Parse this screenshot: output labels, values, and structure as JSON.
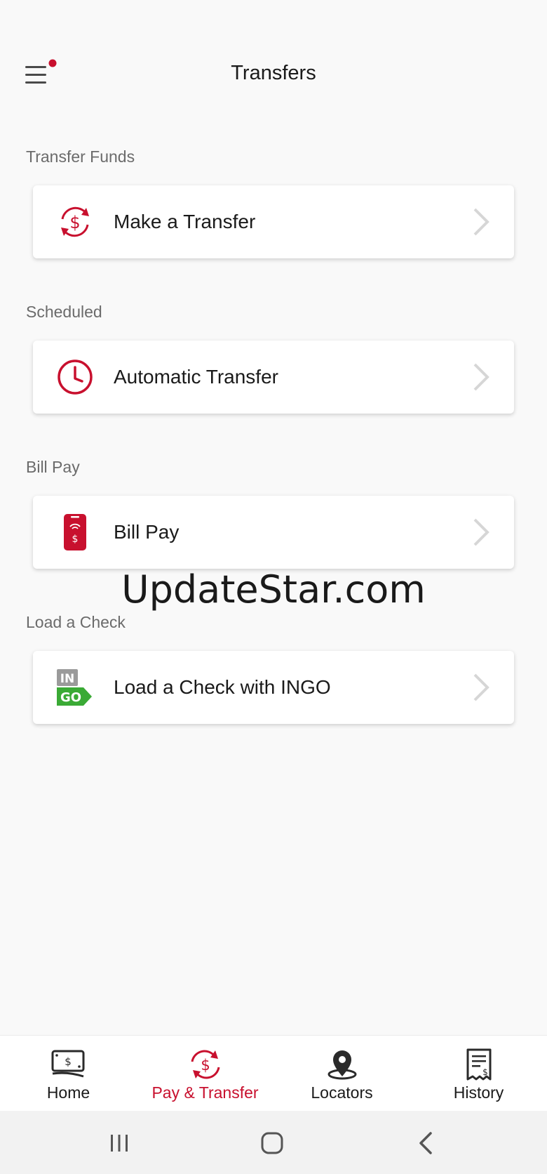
{
  "header": {
    "title": "Transfers",
    "menu_icon": "hamburger-menu-icon",
    "notification_dot_color": "#c8102e"
  },
  "sections": [
    {
      "label": "Transfer Funds",
      "item": {
        "label": "Make a Transfer",
        "icon": "dollar-cycle-icon"
      }
    },
    {
      "label": "Scheduled",
      "item": {
        "label": "Automatic Transfer",
        "icon": "clock-icon"
      }
    },
    {
      "label": "Bill Pay",
      "item": {
        "label": "Bill Pay",
        "icon": "phone-pay-icon"
      }
    },
    {
      "label": "Load a Check",
      "item": {
        "label": "Load a Check with INGO",
        "icon": "ingo-logo-icon"
      }
    }
  ],
  "watermark": "UpdateStar.com",
  "tabbar": {
    "active": "Pay & Transfer",
    "tabs": [
      {
        "label": "Home",
        "icon": "money-icon"
      },
      {
        "label": "Pay & Transfer",
        "icon": "dollar-cycle-icon"
      },
      {
        "label": "Locators",
        "icon": "location-pin-icon"
      },
      {
        "label": "History",
        "icon": "receipt-icon"
      }
    ]
  },
  "colors": {
    "accent": "#c8102e",
    "text": "#1a1a1a",
    "section_label": "#6b6b6b",
    "background": "#f9f9f9",
    "ingo_green": "#3aaa35",
    "ingo_gray": "#9a9a9a"
  }
}
